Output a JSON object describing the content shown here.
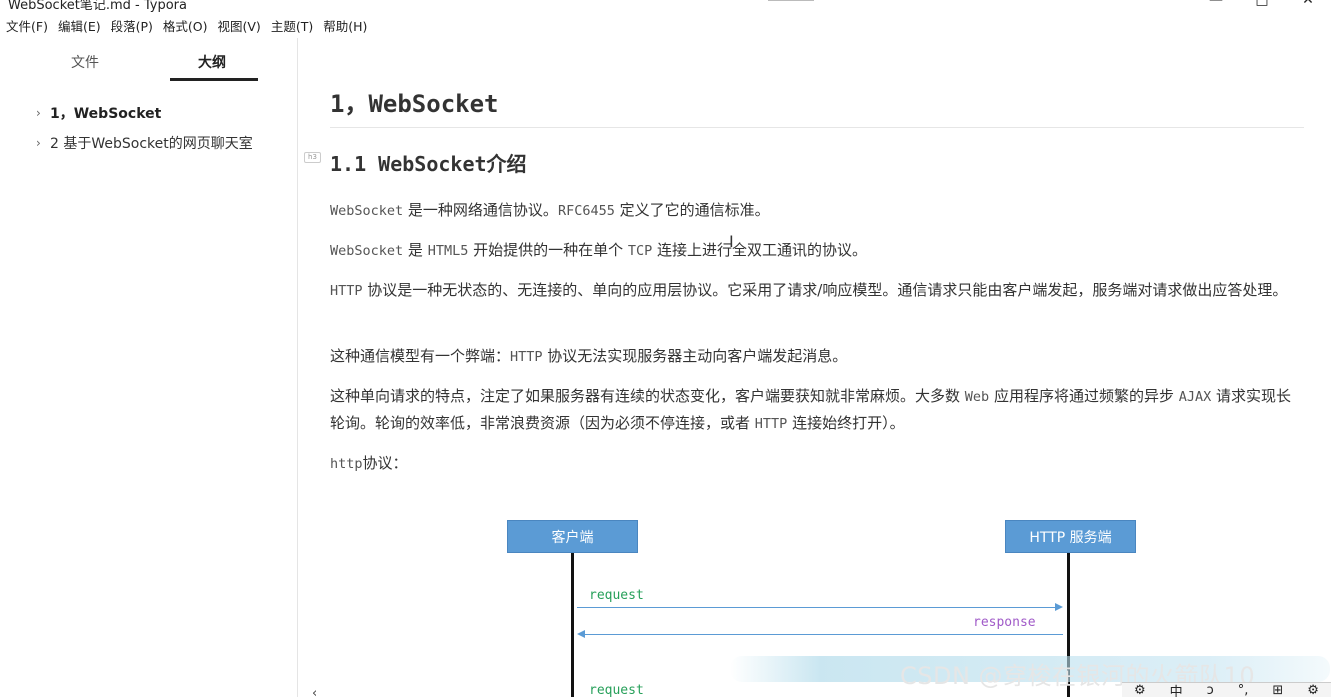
{
  "window": {
    "title": "WebSocket笔记.md - Typora",
    "controls": {
      "minimize": "—",
      "maximize": "□",
      "close": "✕"
    }
  },
  "menu": [
    "文件(F)",
    "编辑(E)",
    "段落(P)",
    "格式(O)",
    "视图(V)",
    "主题(T)",
    "帮助(H)"
  ],
  "sidebar": {
    "tabs": {
      "files": "文件",
      "outline": "大纲"
    },
    "active_tab": "outline",
    "outline": [
      {
        "label": "1，WebSocket",
        "active": true
      },
      {
        "label": "2 基于WebSocket的网页聊天室",
        "active": false
      }
    ],
    "footer": "‹ </>"
  },
  "doc": {
    "h1": "1，WebSocket",
    "h2_marker": "h3",
    "h2": "1.1 WebSocket介绍",
    "p1": {
      "code1": "WebSocket",
      "t1": " 是一种网络通信协议。",
      "code2": "RFC6455",
      "t2": " 定义了它的通信标准。"
    },
    "p2": {
      "code1": "WebSocket",
      "t1": " 是 ",
      "code2": "HTML5",
      "t2": " 开始提供的一种在单个 ",
      "code3": "TCP",
      "t3": " 连接上进行全双工通讯的协议。"
    },
    "p3": {
      "code1": "HTTP",
      "t1": " 协议是一种无状态的、无连接的、单向的应用层协议。它采用了请求/响应模型。通信请求只能由客户端发起，服务端对请求做出应答处理。"
    },
    "p4": {
      "t1": "这种通信模型有一个弊端：",
      "code1": "HTTP",
      "t2": " 协议无法实现服务器主动向客户端发起消息。"
    },
    "p5": {
      "t1": "这种单向请求的特点，注定了如果服务器有连续的状态变化，客户端要获知就非常麻烦。大多数 ",
      "code1": "Web",
      "t2": " 应用程序将通过频繁的异步 ",
      "code2": "AJAX",
      "t3": " 请求实现长轮询。轮询的效率低，非常浪费资源（因为必须不停连接，或者 ",
      "code3": "HTTP",
      "t4": " 连接始终打开）。"
    },
    "p6": {
      "code1": "http",
      "t1": "协议："
    }
  },
  "diagram": {
    "client": "客户端",
    "server": "HTTP 服务端",
    "messages": [
      {
        "label": "request",
        "dir": "right"
      },
      {
        "label": "response",
        "dir": "left"
      },
      {
        "label": "request",
        "dir": "right"
      }
    ]
  },
  "watermark": "CSDN @穿梭在银河的火箭队10",
  "ime": [
    "⚙",
    "中",
    "ɔ",
    "°,",
    "⊞",
    "⚙"
  ]
}
